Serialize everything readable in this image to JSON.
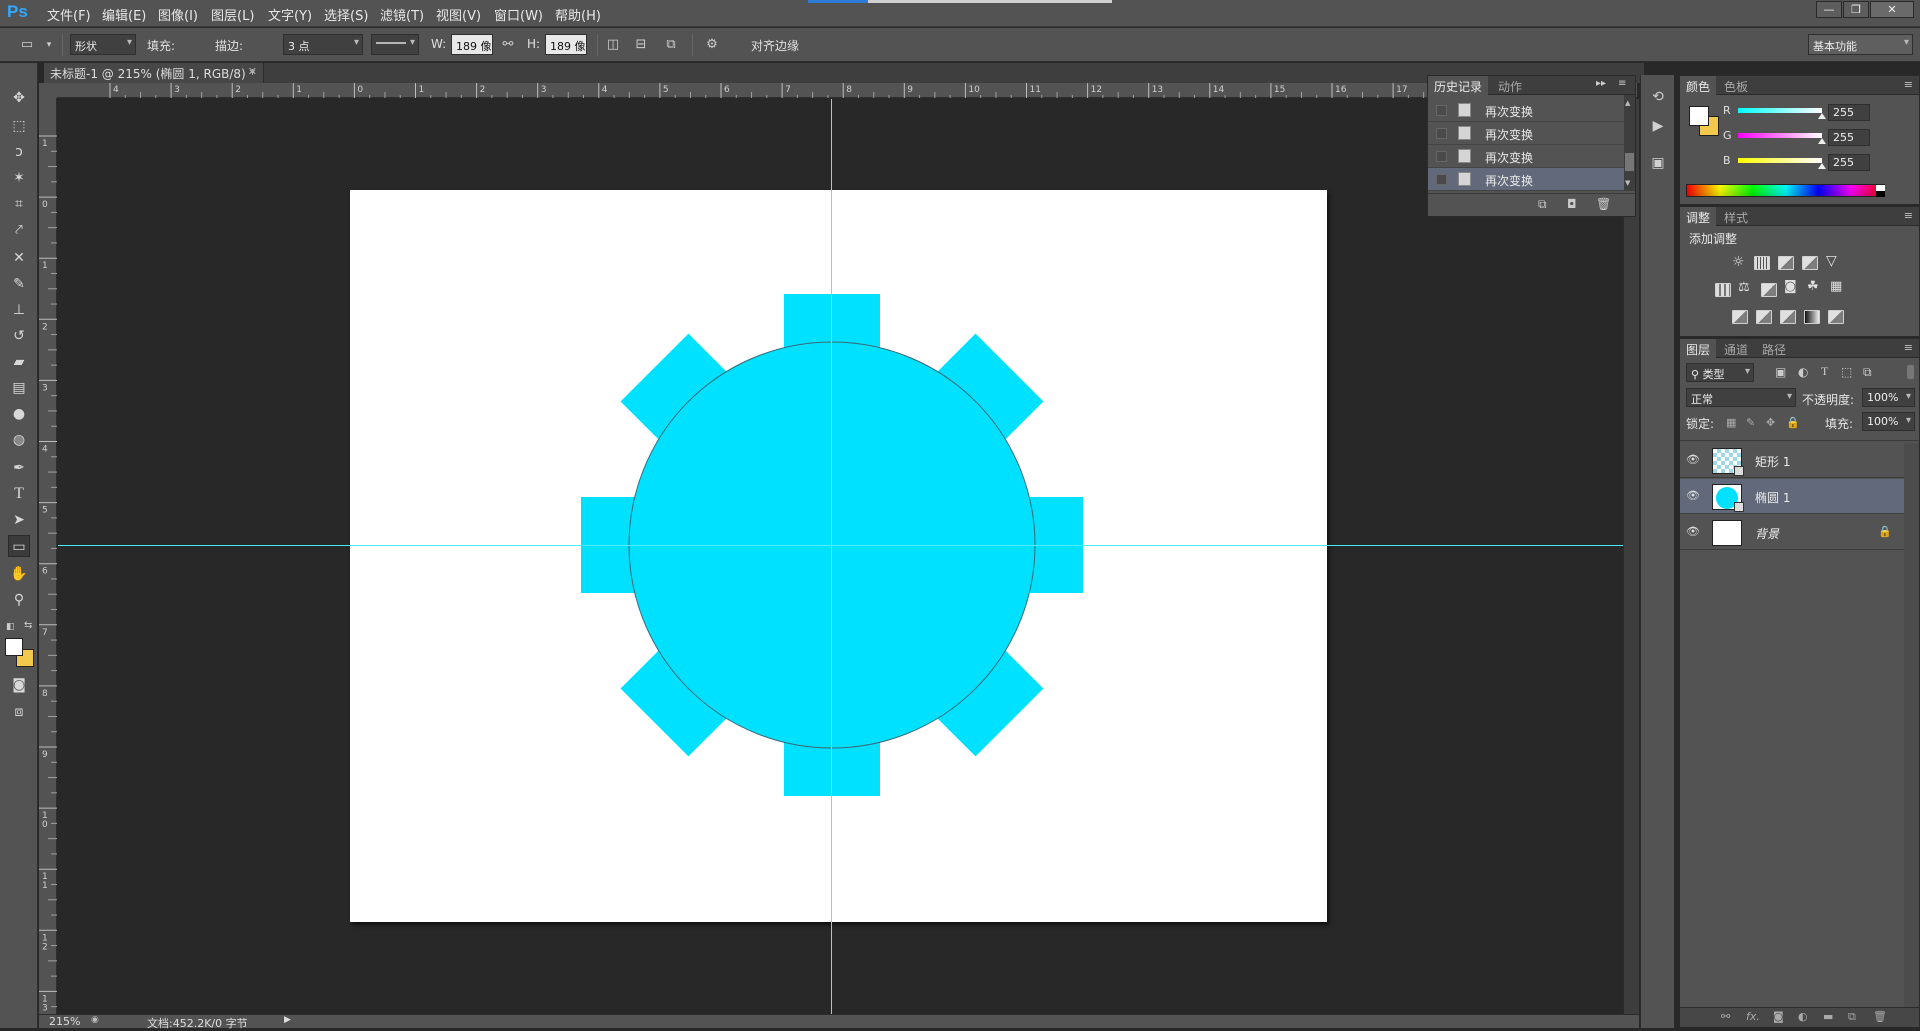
{
  "app": {
    "logo": "Ps",
    "menu": [
      "文件(F)",
      "编辑(E)",
      "图像(I)",
      "图层(L)",
      "文字(Y)",
      "选择(S)",
      "滤镜(T)",
      "视图(V)",
      "窗口(W)",
      "帮助(H)"
    ],
    "window_buttons": [
      "—",
      "❐",
      "✕"
    ]
  },
  "options_bar": {
    "mode": "形状",
    "fill_label": "填充:",
    "fill_color": "#00e0ff",
    "stroke_label": "描边:",
    "stroke_width": "3 点",
    "w_label": "W:",
    "w_value": "189 像",
    "h_label": "H:",
    "h_value": "189 像",
    "align_edges": "对齐边缘",
    "workspace": "基本功能"
  },
  "document": {
    "tab_title": "未标题-1 @ 215% (椭圆 1, RGB/8) *",
    "zoom": "215%",
    "doc_info": "文档:452.2K/0 字节",
    "shape_color": "#00e0ff",
    "guide_color": "#44eeff"
  },
  "rulers": {
    "top": [
      "4",
      "3",
      "2",
      "1",
      "0",
      "1",
      "2",
      "3",
      "4",
      "5",
      "6",
      "7",
      "8",
      "9",
      "10",
      "11",
      "12",
      "13",
      "14",
      "15",
      "16",
      "17"
    ],
    "left": [
      "1",
      "0",
      "1",
      "2",
      "3",
      "4",
      "5",
      "6",
      "7",
      "8",
      "9",
      "10",
      "11",
      "12",
      "13"
    ]
  },
  "history": {
    "tabs": [
      "历史记录",
      "动作"
    ],
    "items": [
      "再次变换",
      "再次变换",
      "再次变换",
      "再次变换"
    ],
    "selected_index": 3
  },
  "color": {
    "tabs": [
      "颜色",
      "色板"
    ],
    "channels": [
      {
        "name": "R",
        "value": "255",
        "color": "#00ffff"
      },
      {
        "name": "G",
        "value": "255",
        "color": "#ff00ff"
      },
      {
        "name": "B",
        "value": "255",
        "color": "#ffff00"
      }
    ],
    "foreground": "#ffffff",
    "background": "#f2c94c"
  },
  "adjustments": {
    "tabs": [
      "调整",
      "样式"
    ],
    "title": "添加调整"
  },
  "layers": {
    "tabs": [
      "图层",
      "通道",
      "路径"
    ],
    "filter": "类型",
    "blend_mode": "正常",
    "opacity_label": "不透明度:",
    "opacity": "100%",
    "lock_label": "锁定:",
    "fill_label": "填充:",
    "fill": "100%",
    "items": [
      {
        "name": "矩形 1"
      },
      {
        "name": "椭圆 1"
      },
      {
        "name": "背景"
      }
    ],
    "selected_index": 1
  }
}
